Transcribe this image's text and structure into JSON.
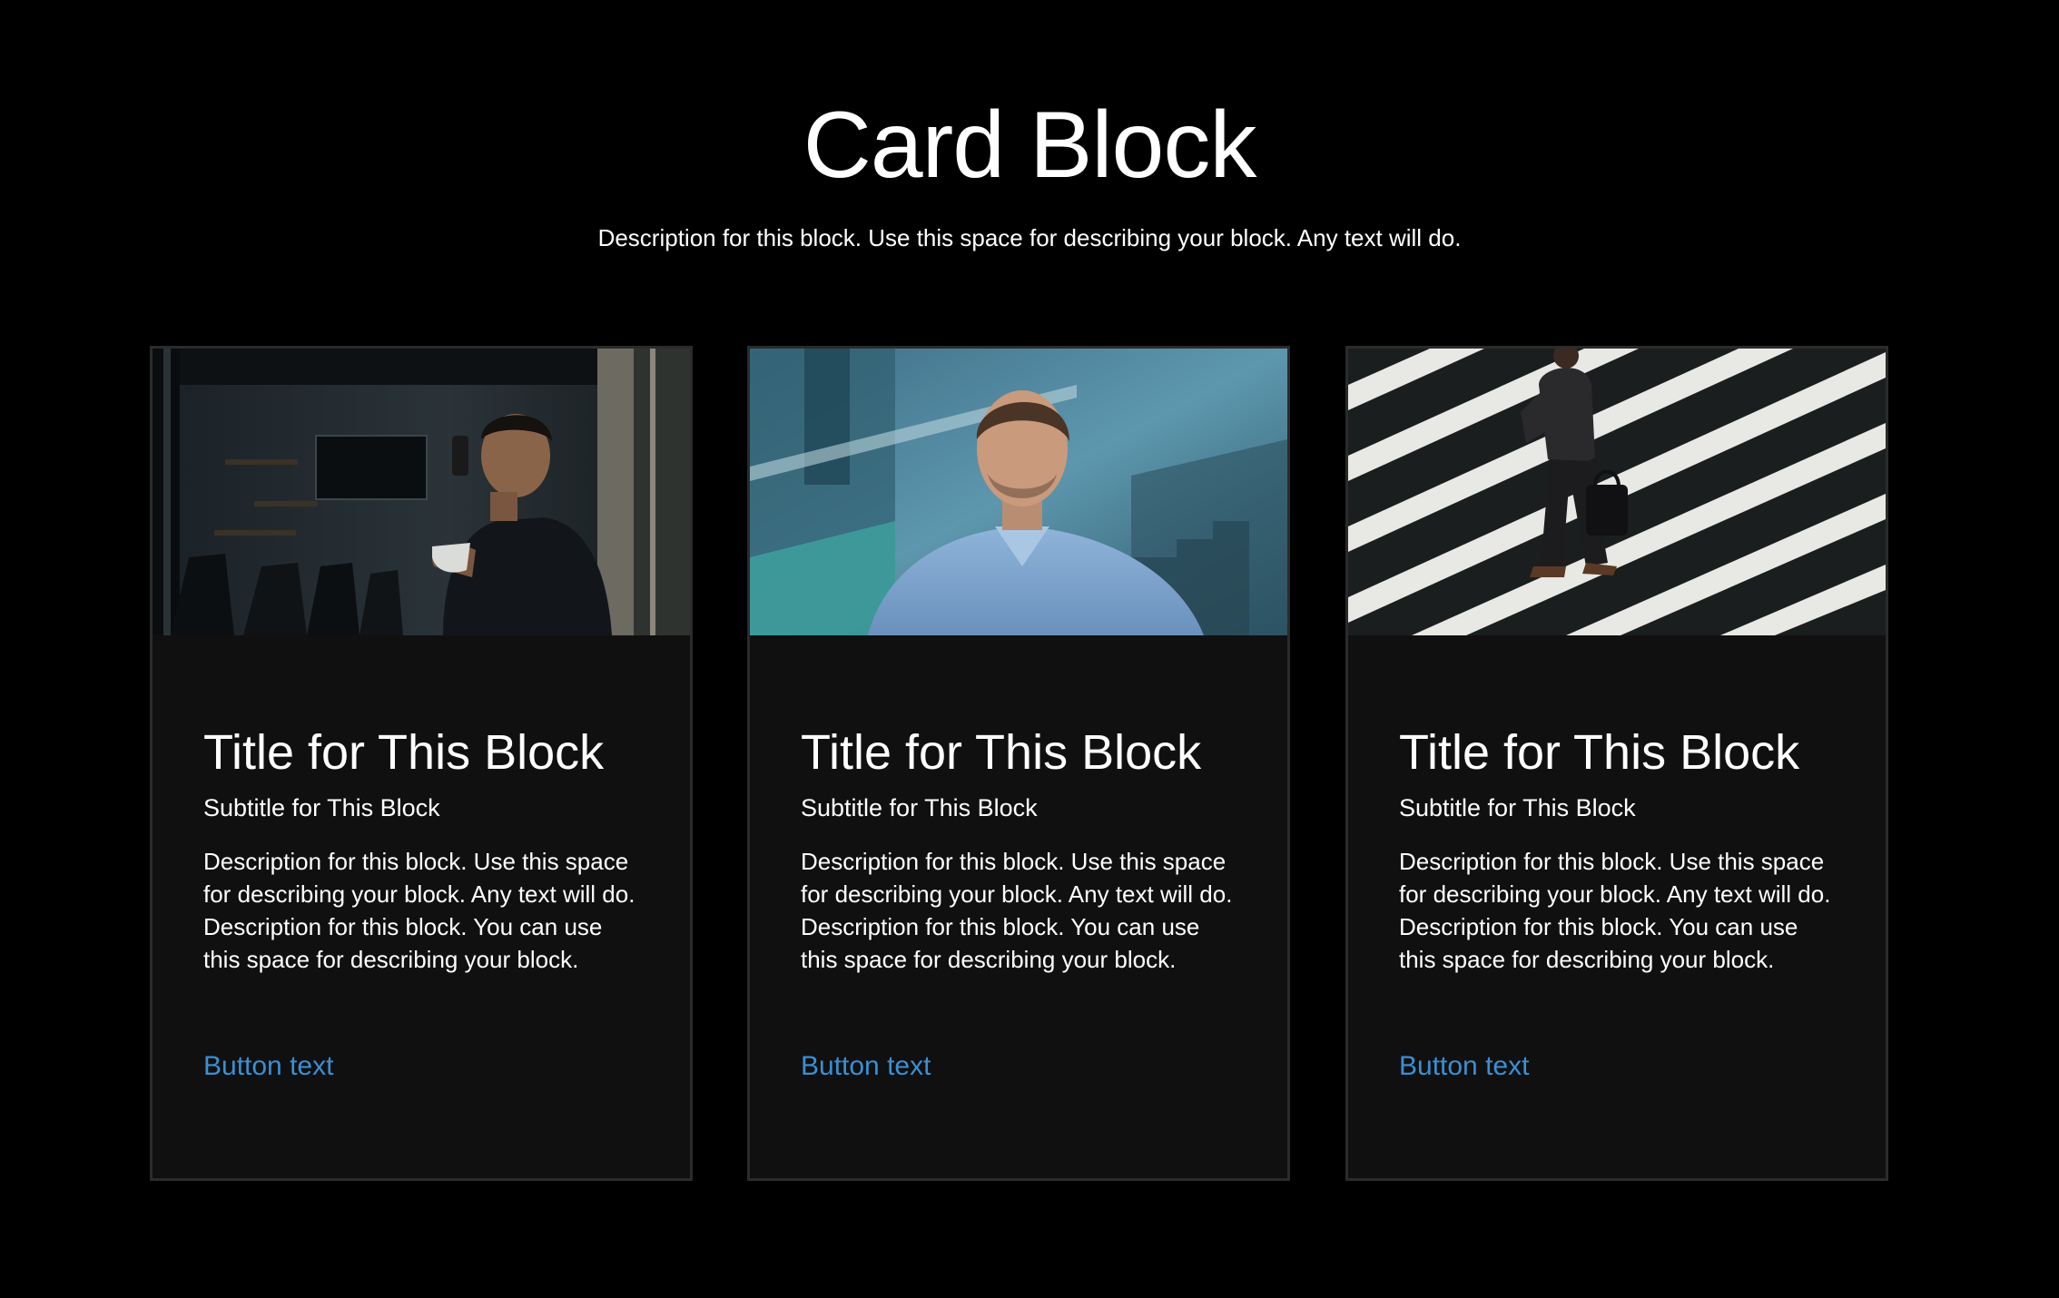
{
  "header": {
    "title": "Card Block",
    "description": "Description for this block. Use this space for describing your block. Any text will do."
  },
  "colors": {
    "background": "#000000",
    "card_background": "#101010",
    "card_border": "#2b2b2b",
    "link": "#3b8fd4"
  },
  "cards": [
    {
      "image_subject": "businessman on phone holding coffee cup in conference room",
      "title": "Title for This Block",
      "subtitle": "Subtitle for This Block",
      "description": "Description for this block. Use this space for describing your block. Any text will do. Description for this block. You can use this space for describing your block.",
      "button": "Button text"
    },
    {
      "image_subject": "man in light blue shirt in front of glass building",
      "title": "Title for This Block",
      "subtitle": "Subtitle for This Block",
      "description": "Description for this block. Use this space for describing your block. Any text will do. Description for this block. You can use this space for describing your block.",
      "button": "Button text"
    },
    {
      "image_subject": "businessman with briefcase walking across zebra crosswalk",
      "title": "Title for This Block",
      "subtitle": "Subtitle for This Block",
      "description": "Description for this block. Use this space for describing your block. Any text will do. Description for this block. You can use this space for describing your block.",
      "button": "Button text"
    }
  ]
}
